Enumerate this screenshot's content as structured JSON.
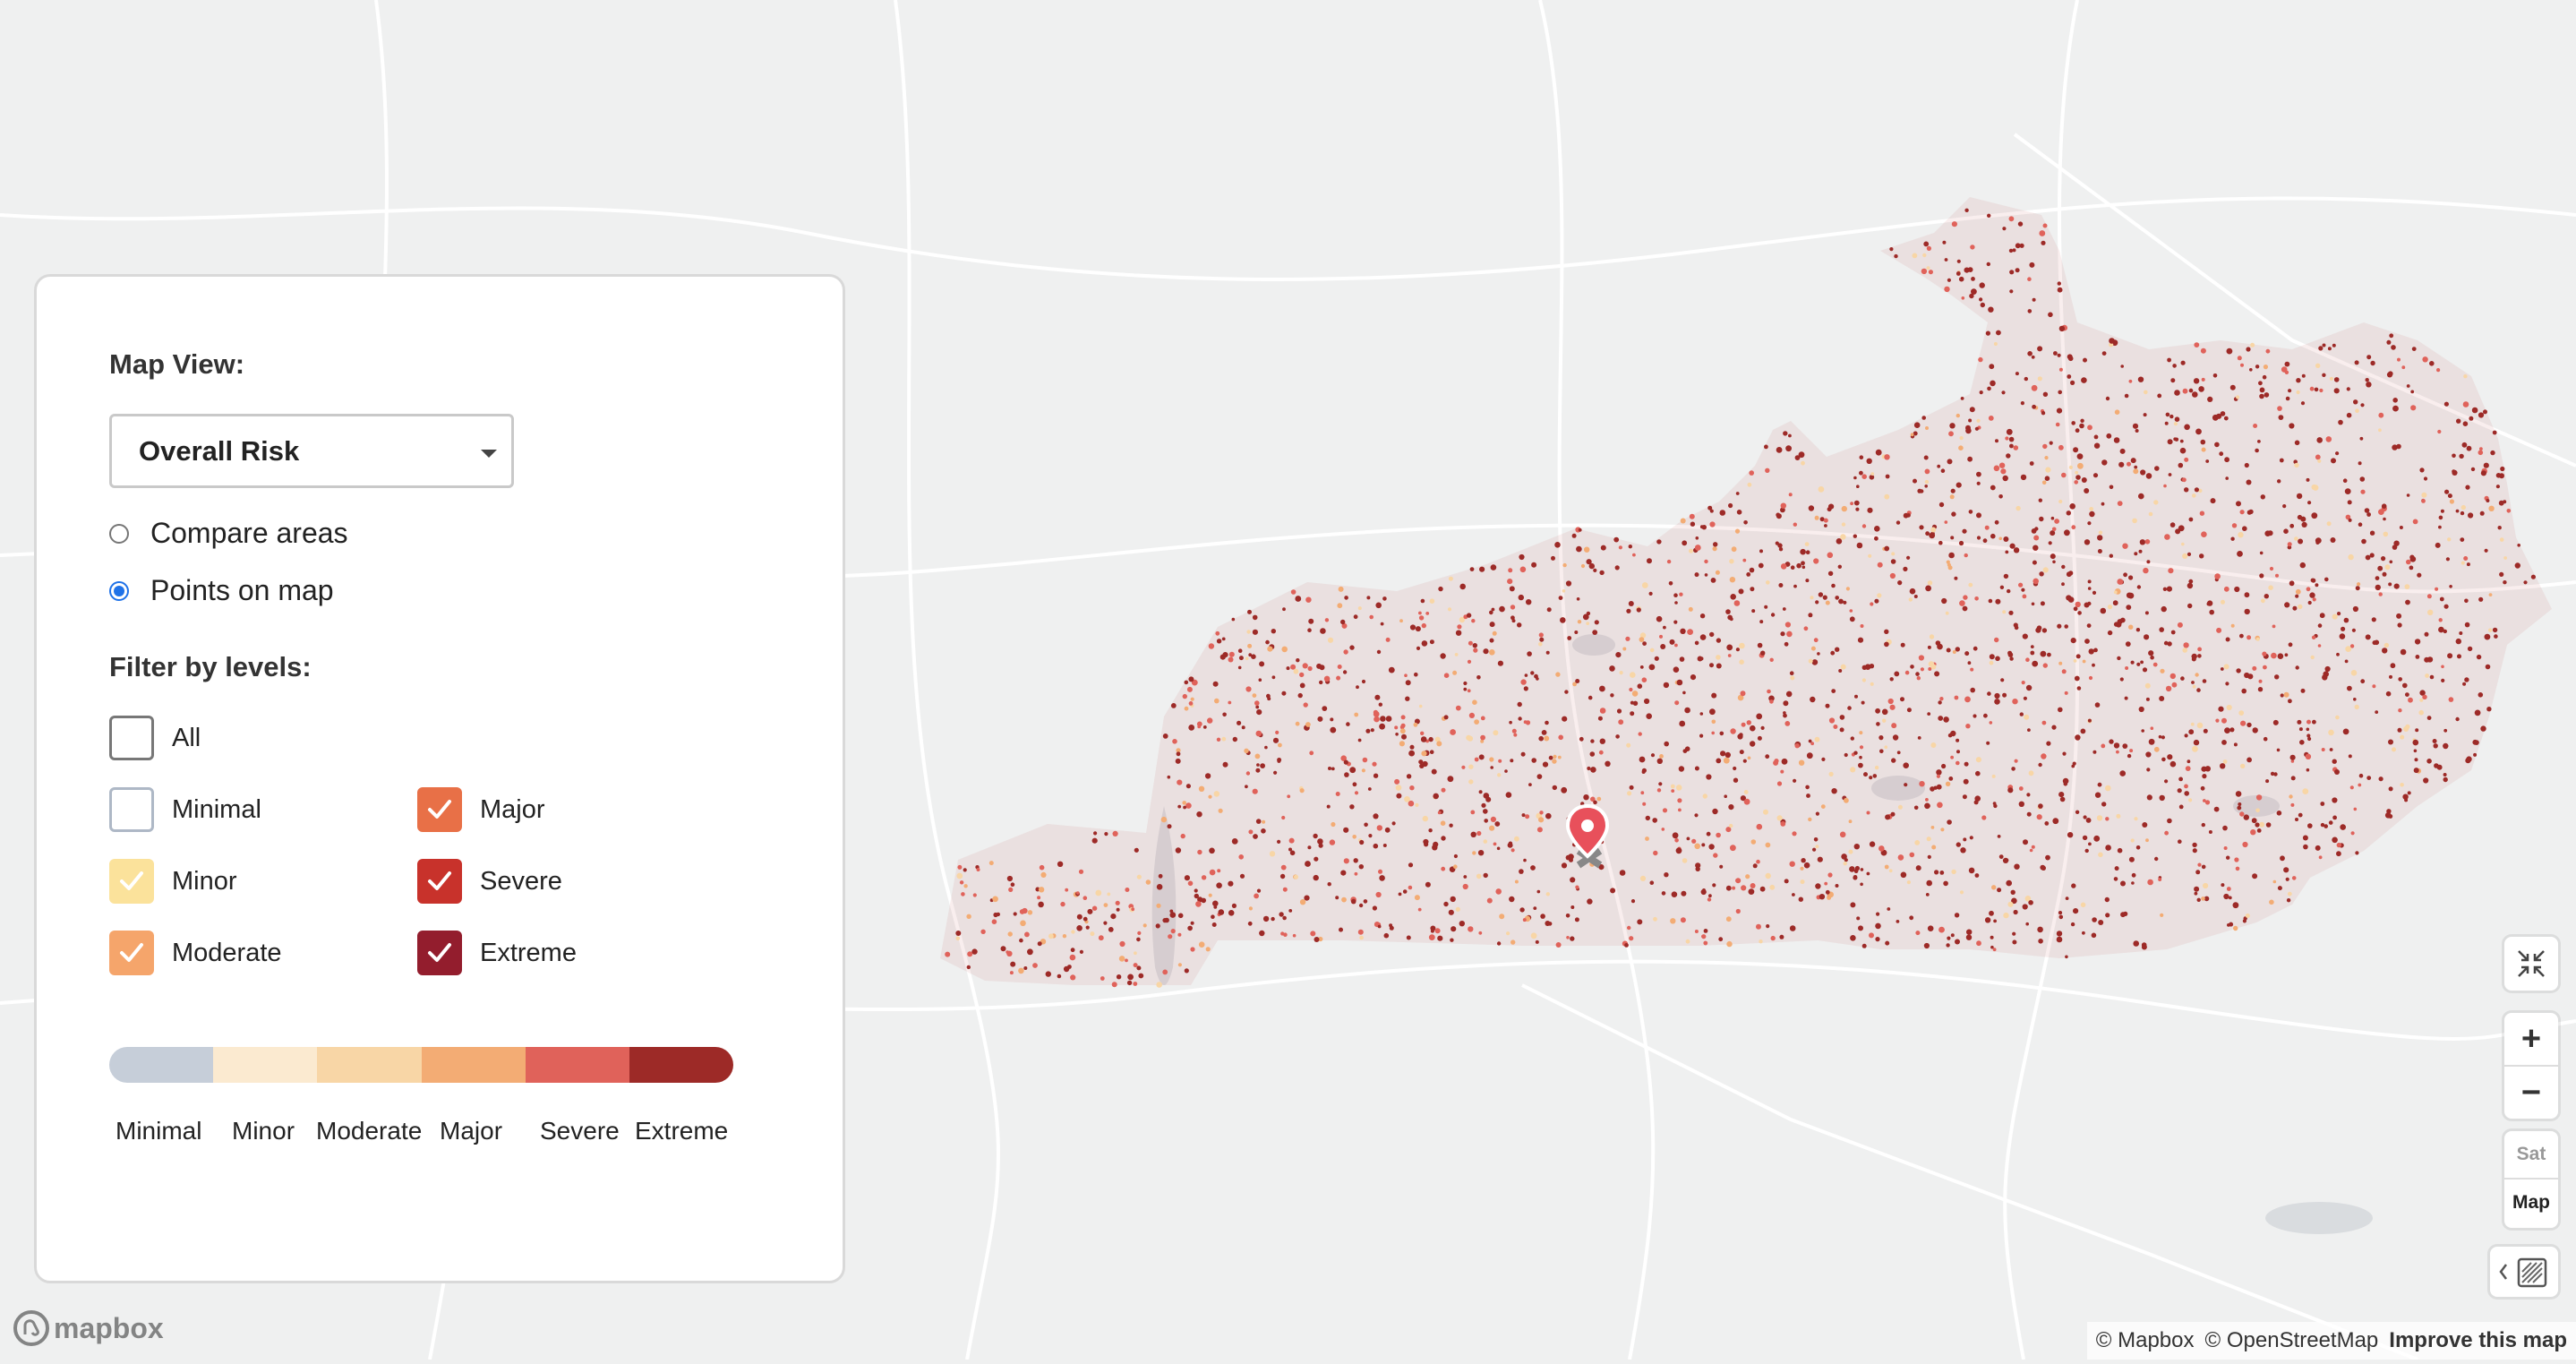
{
  "panel": {
    "map_view_label": "Map View:",
    "select": {
      "value": "Overall Risk"
    },
    "radios": [
      {
        "label": "Compare areas",
        "checked": false
      },
      {
        "label": "Points on map",
        "checked": true
      }
    ],
    "filter_label": "Filter by levels:",
    "levels": [
      {
        "label": "All",
        "checked": false,
        "color": "#ffffff"
      },
      {
        "label": "Minimal",
        "checked": false,
        "color": "#ffffff"
      },
      {
        "label": "Major",
        "checked": true,
        "color": "#e87047"
      },
      {
        "label": "Minor",
        "checked": true,
        "color": "#fbe29b"
      },
      {
        "label": "Severe",
        "checked": true,
        "color": "#c8322b"
      },
      {
        "label": "Moderate",
        "checked": true,
        "color": "#f5a56b"
      },
      {
        "label": "Extreme",
        "checked": true,
        "color": "#931d2d"
      }
    ],
    "legend": [
      {
        "label": "Minimal",
        "color": "#c6ced9"
      },
      {
        "label": "Minor",
        "color": "#fbead0"
      },
      {
        "label": "Moderate",
        "color": "#f8d6a6"
      },
      {
        "label": "Major",
        "color": "#f3ac74"
      },
      {
        "label": "Severe",
        "color": "#e0625a"
      },
      {
        "label": "Extreme",
        "color": "#9d2a27"
      }
    ]
  },
  "controls": {
    "zoom_in": "+",
    "zoom_out": "−",
    "style_sat": "Sat",
    "style_map": "Map"
  },
  "attribution": {
    "mapbox": "© Mapbox",
    "osm": "© OpenStreetMap",
    "improve": "Improve this map"
  },
  "logo": "mapbox",
  "colors": {
    "accent_radio": "#1f72e8",
    "marker": "#e8505b"
  }
}
